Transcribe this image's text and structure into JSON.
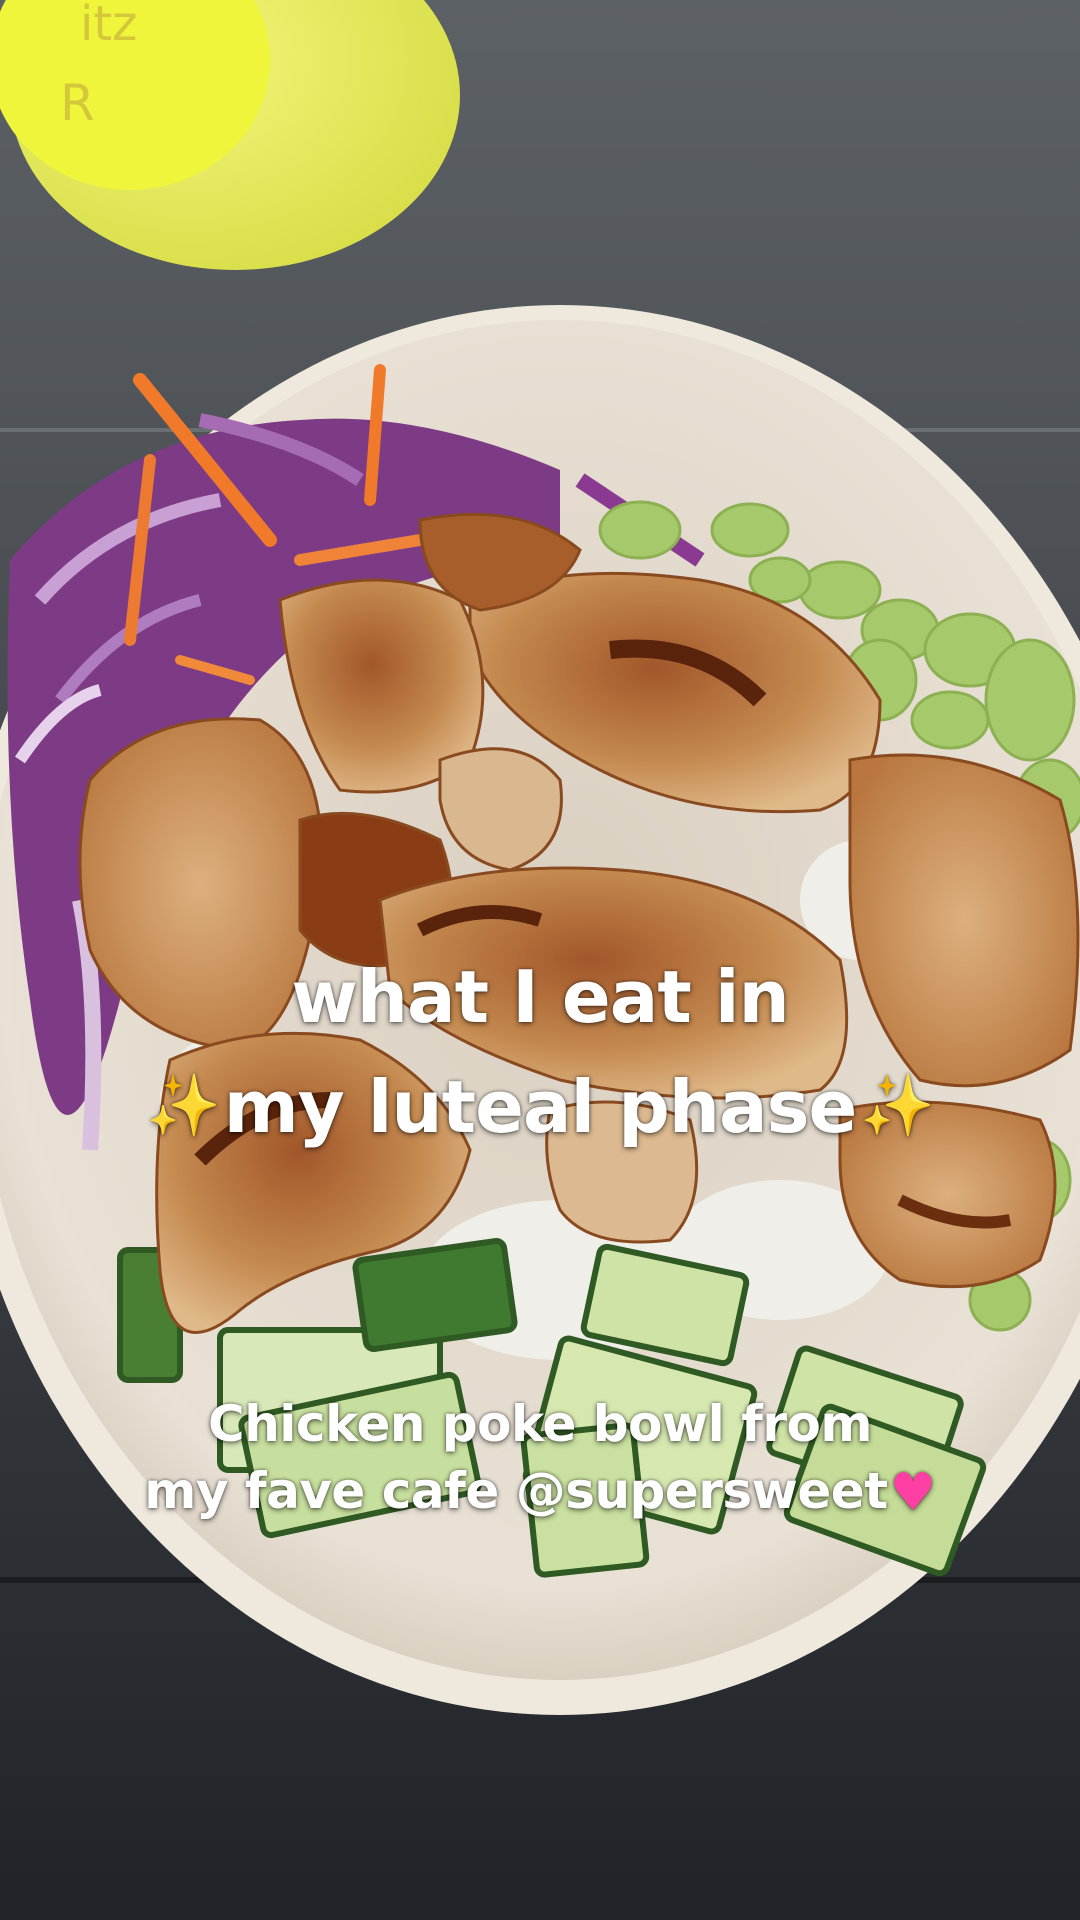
{
  "overlay": {
    "title_line1": "what I eat in",
    "title_line2": "my luteal phase",
    "caption_line1": "Chicken poke bowl from",
    "caption_line2": "my fave cafe @supersweet"
  },
  "icons": {
    "sparkle": "✨",
    "heart": "♥"
  },
  "colors": {
    "text": "#ffffff",
    "sparkle": "#ffd43b",
    "heart": "#ff3fa4",
    "table": "#2b2e33",
    "bowl": "#e6ddd0"
  }
}
